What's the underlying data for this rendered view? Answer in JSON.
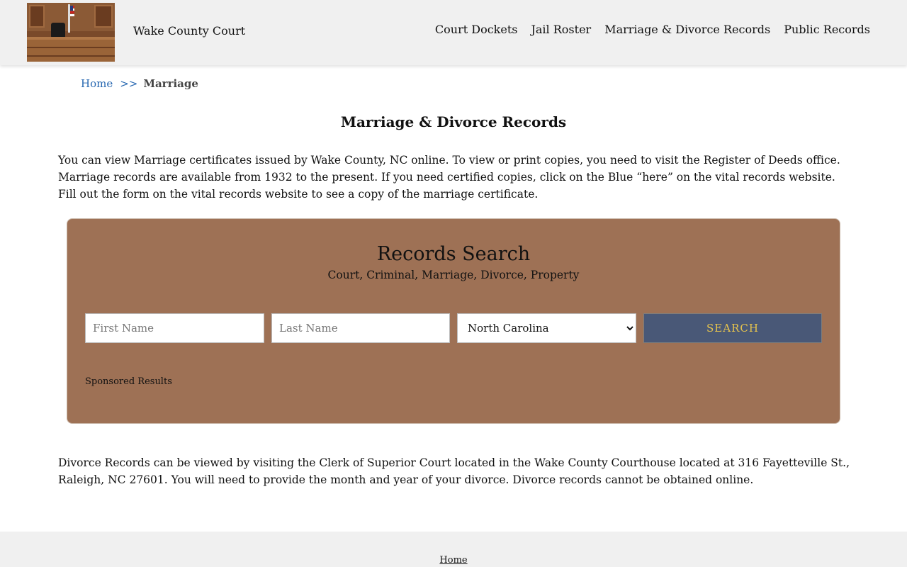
{
  "header": {
    "site_title": "Wake County Court",
    "nav": [
      {
        "label": "Court Dockets"
      },
      {
        "label": "Jail Roster"
      },
      {
        "label": "Marriage & Divorce Records"
      },
      {
        "label": "Public Records"
      }
    ]
  },
  "breadcrumb": {
    "home": "Home",
    "separator": ">>",
    "current": "Marriage"
  },
  "main": {
    "title": "Marriage & Divorce Records",
    "intro": "You can view Marriage certificates issued by Wake County, NC online. To view or print copies, you need to visit the Register of Deeds office. Marriage records are available from 1932 to the present. If you need certified copies, click on the Blue “here” on the vital records website. Fill out the form on the vital records website to see a copy of the marriage certificate.",
    "divorce_text": "Divorce Records can be viewed by visiting the Clerk of Superior Court located in the Wake County Courthouse located at 316 Fayetteville St., Raleigh, NC 27601. You will need to provide the month and year of your divorce. Divorce records cannot be obtained online."
  },
  "search": {
    "title": "Records Search",
    "subtitle": "Court, Criminal, Marriage, Divorce, Property",
    "first_name_placeholder": "First Name",
    "last_name_placeholder": "Last Name",
    "state_selected": "North Carolina",
    "button_label": "SEARCH",
    "sponsored": "Sponsored Results"
  },
  "footer": {
    "home": "Home"
  },
  "colors": {
    "header_bg": "#f0f0f0",
    "search_bg": "#9e7155",
    "button_bg": "#495877",
    "button_text": "#e7c44d",
    "link": "#2566b0"
  }
}
